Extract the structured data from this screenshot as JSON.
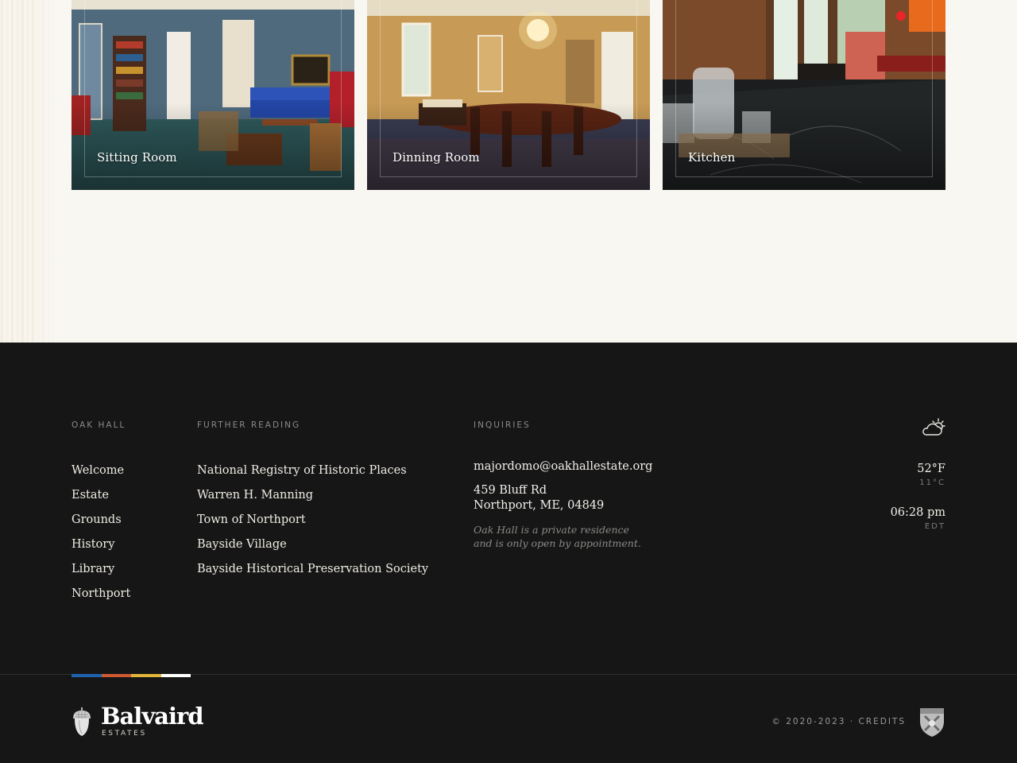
{
  "rooms": [
    {
      "label": "Sitting Room"
    },
    {
      "label": "Dinning Room"
    },
    {
      "label": "Kitchen"
    }
  ],
  "footer": {
    "col1": {
      "heading": "OAK HALL",
      "links": [
        "Welcome",
        "Estate",
        "Grounds",
        "History",
        "Library",
        "Northport"
      ]
    },
    "col2": {
      "heading": "FURTHER READING",
      "links": [
        "National Registry of Historic Places",
        "Warren H. Manning",
        "Town of Northport",
        "Bayside Village",
        "Bayside Historical Preservation Society"
      ]
    },
    "col3": {
      "heading": "INQUIRIES",
      "email": "majordomo@oakhallestate.org",
      "address_line1": "459 Bluff Rd",
      "address_line2": "Northport, ME, 04849",
      "note_line1": "Oak Hall is a private residence",
      "note_line2": "and is only open by appointment."
    },
    "weather": {
      "icon": "partly-cloudy-icon",
      "temp_f": "52°F",
      "temp_c": "11°C",
      "time": "06:28 pm",
      "timezone": "EDT"
    },
    "brand": {
      "name": "Balvaird",
      "tagline": "ESTATES",
      "colors": [
        "#1f62b0",
        "#d15a32",
        "#e2b437",
        "#ffffff"
      ]
    },
    "copyright": "© 2020-2023 · CREDITS"
  }
}
